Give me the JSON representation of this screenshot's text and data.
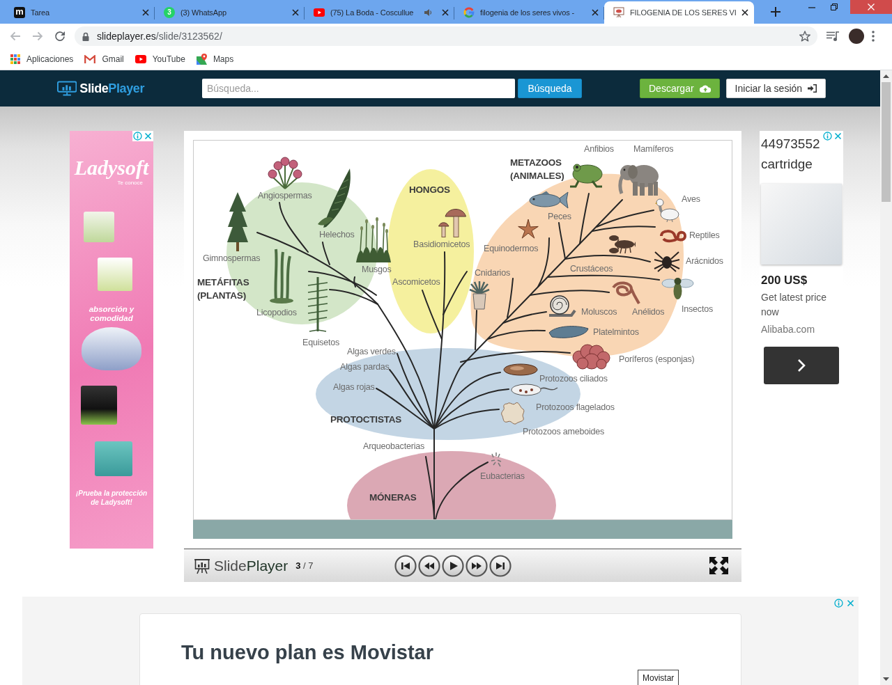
{
  "browser": {
    "tabs": [
      {
        "title": "Tarea",
        "kind": "letter",
        "icon_text": "m",
        "audio": false,
        "selected": false
      },
      {
        "title": "(3) WhatsApp",
        "kind": "chat",
        "icon_text": "3",
        "audio": false,
        "selected": false
      },
      {
        "title": "(75) La Boda - Coscullue",
        "kind": "video",
        "audio": true,
        "selected": false
      },
      {
        "title": "filogenia de los seres vivos -",
        "kind": "search",
        "audio": false,
        "selected": false
      },
      {
        "title": "FILOGENIA DE LOS SERES VI",
        "kind": "slides",
        "audio": false,
        "selected": true
      }
    ],
    "back": {
      "disabled": true
    },
    "forward": {
      "disabled": true
    },
    "address": {
      "host": "slideplayer.es",
      "path": "/slide/3123562/"
    },
    "bookmarks": [
      {
        "label": "Aplicaciones",
        "kind": "apps"
      },
      {
        "label": "Gmail",
        "kind": "mail"
      },
      {
        "label": "YouTube",
        "kind": "video"
      },
      {
        "label": "Maps",
        "kind": "map"
      }
    ]
  },
  "site_header": {
    "logo": [
      "Slide",
      "Player"
    ],
    "search": {
      "placeholder": "Búsqueda..."
    },
    "search_button": "Búsqueda",
    "download_button": "Descargar",
    "login_button": "Iniciar la sesión"
  },
  "left_ad": {
    "logo": "Ladysoft",
    "tagline": "Te conoce",
    "claim": "absorción y comodidad",
    "slogan": "¡Prueba la protección de Ladysoft!"
  },
  "slide": {
    "groups": [
      {
        "title": [
          "METÁFITAS",
          "(PLANTAS)"
        ],
        "color": "#d3e6c8",
        "labels": [
          "Angiospermas",
          "Gimnospermas",
          "Helechos",
          "Musgos",
          "Licopodios",
          "Equisetos"
        ]
      },
      {
        "title": [
          "HONGOS"
        ],
        "color": "#f5f09e",
        "labels": [
          "Basidiomicetos",
          "Ascomicetos"
        ]
      },
      {
        "title": [
          "METAZOOS",
          "(ANIMALES)"
        ],
        "color": "#f9d6b4",
        "labels": [
          "Anfibios",
          "Mamíferos",
          "Aves",
          "Peces",
          "Equinodermos",
          "Reptiles",
          "Crustáceos",
          "Arácnidos",
          "Cnidarios",
          "Insectos",
          "Moluscos",
          "Anélidos",
          "Platelmintos",
          "Poríferos (esponjas)"
        ]
      },
      {
        "title": [
          "PROTOCTISTAS"
        ],
        "color": "#c3d5e4",
        "labels": [
          "Algas verdes",
          "Algas pardas",
          "Algas rojas",
          "Protozoos ciliados",
          "Protozoos flagelados",
          "Protozoos ameboides"
        ]
      },
      {
        "title": [
          "MÓNERAS"
        ],
        "color": "#dba8b4",
        "labels": [
          "Arqueobacterias",
          "Eubacterias"
        ]
      }
    ],
    "player": {
      "logo": [
        "Slide",
        "Player"
      ],
      "counter": "**3** / 7"
    }
  },
  "right_ad": {
    "title": "44973552 cartridge",
    "price": "200 US$",
    "cta": "Get latest price now",
    "source": "Alibaba.com"
  },
  "bottom_ad": {
    "title": "Tu nuevo plan es Movistar",
    "advertiser": "Movistar"
  }
}
